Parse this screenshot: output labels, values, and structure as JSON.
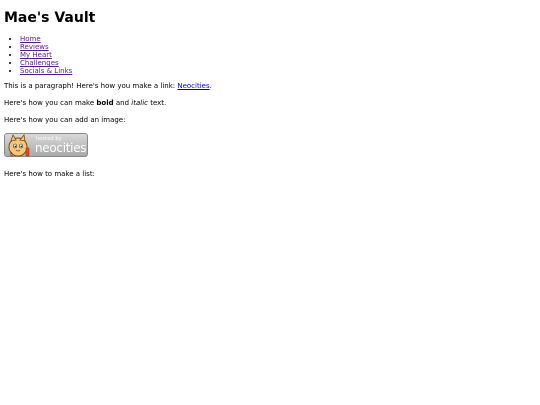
{
  "title": "Mae's Vault",
  "nav": [
    {
      "label": "Home",
      "visited": true
    },
    {
      "label": "Reviews",
      "visited": true
    },
    {
      "label": "My Heart",
      "visited": true
    },
    {
      "label": "Challenges",
      "visited": true
    },
    {
      "label": "Socials & Links",
      "visited": true
    }
  ],
  "para1": {
    "prefix": "This is a paragraph! Here's how you make a link: ",
    "link": "Neocities",
    "suffix": "."
  },
  "para2": {
    "prefix": "Here's how you can make ",
    "bold": "bold",
    "middle": " and ",
    "italic": "italic",
    "suffix": " text."
  },
  "para3": "Here's how you can add an image:",
  "badge": {
    "small": "hosted by",
    "big": "neocities",
    "icon": "neocities-cat-icon"
  },
  "para4": "Here's how to make a list:",
  "colors": {
    "link": "#0000ee",
    "visited_link": "#551a8b"
  }
}
